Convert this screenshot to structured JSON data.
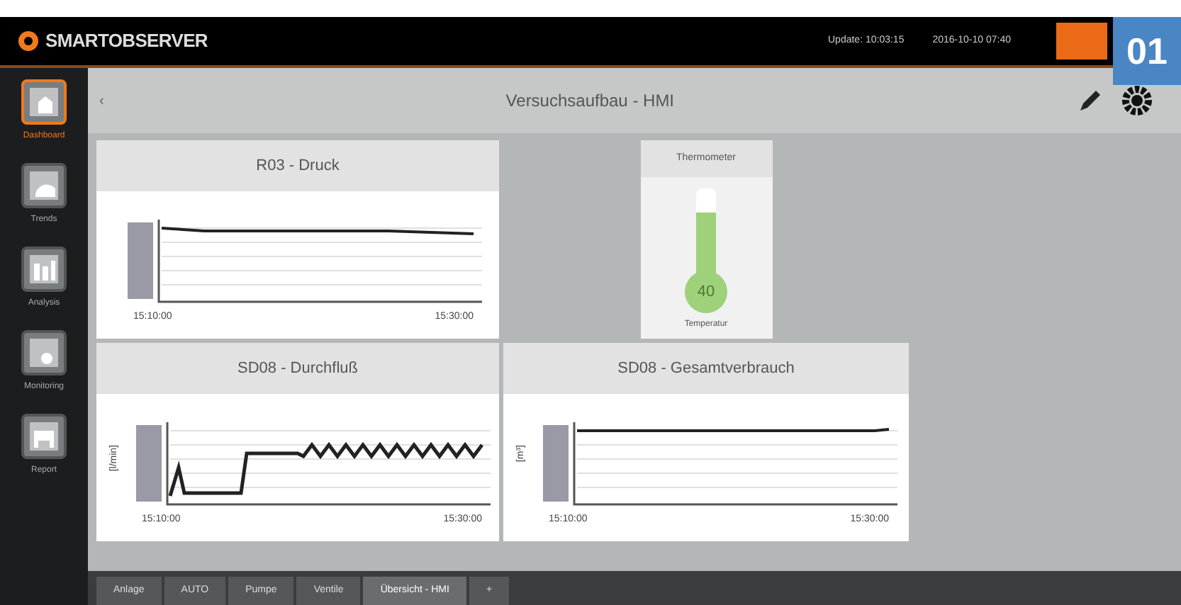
{
  "header": {
    "logo": "SMARTOBSERVER",
    "update": "Update: 10:03:15",
    "date": "2016-10-10 07:40",
    "badge": "01"
  },
  "sidebar": {
    "items": [
      {
        "label": "Dashboard",
        "selected": true
      },
      {
        "label": "Trends",
        "selected": false
      },
      {
        "label": "Analysis",
        "selected": false
      },
      {
        "label": "Monitoring",
        "selected": false
      },
      {
        "label": "Report",
        "selected": false
      }
    ]
  },
  "title_bar": {
    "back": "‹",
    "title": "Versuchsaufbau - HMI"
  },
  "cards": [
    {
      "kind": "chart",
      "title": "R03 - Druck",
      "x_start": "15:10:00",
      "x_end": "15:30:00"
    },
    {
      "kind": "gauge",
      "title": "Thermometer",
      "level": 0.72,
      "reading": "40",
      "caption": "Temperatur"
    },
    {
      "kind": "chart",
      "title": "SD08 - Durchfluß",
      "x_start": "15:10:00",
      "x_end": "15:30:00",
      "ylabel": "[l/min]"
    },
    {
      "kind": "chart",
      "title": "SD08 - Gesamtverbrauch",
      "x_start": "15:10:00",
      "x_end": "15:30:00",
      "ylabel": "[m³]"
    }
  ],
  "tabs": [
    {
      "label": "Anlage",
      "selected": false
    },
    {
      "label": "AUTO",
      "selected": false
    },
    {
      "label": "Pumpe",
      "selected": false
    },
    {
      "label": "Ventile",
      "selected": false
    },
    {
      "label": "Übersicht - HMI",
      "selected": true
    },
    {
      "label": "+",
      "selected": false
    }
  ]
}
